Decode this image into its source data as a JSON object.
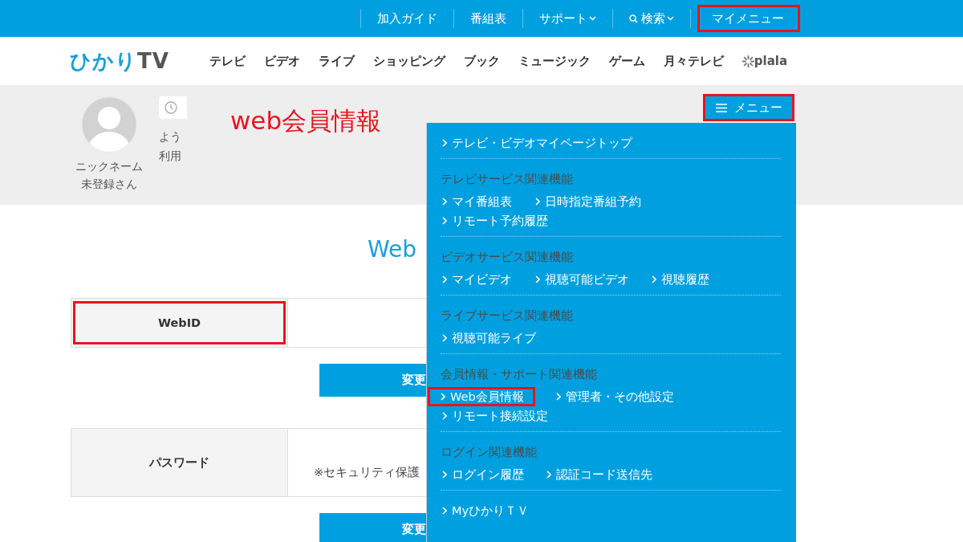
{
  "top_bar": {
    "links": [
      {
        "label": "加入ガイド",
        "kind": "link",
        "highlighted": false
      },
      {
        "label": "番組表",
        "kind": "link",
        "highlighted": false
      },
      {
        "label": "サポート",
        "kind": "dropdown",
        "highlighted": false
      },
      {
        "label": "検索",
        "kind": "search",
        "highlighted": false
      },
      {
        "label": "マイメニュー",
        "kind": "link",
        "highlighted": true
      }
    ]
  },
  "site_nav": {
    "logo_parts": [
      "ひかり",
      "TV"
    ],
    "items": [
      "テレビ",
      "ビデオ",
      "ライブ",
      "ショッピング",
      "ブック",
      "ミュージック",
      "ゲーム",
      "月々テレビ"
    ],
    "partner": "plala"
  },
  "profile": {
    "nickname_lines": [
      "ニックネーム",
      "未登録さん"
    ],
    "welcome_lines": [
      "よう",
      "利用"
    ]
  },
  "annotation": {
    "text": "web会員情報"
  },
  "menu_button": {
    "label": "メニュー",
    "highlighted": true
  },
  "page": {
    "title": "Web",
    "rows": [
      {
        "label": "WebID",
        "highlighted": true,
        "button": "変更"
      },
      {
        "label": "パスワード",
        "highlighted": false,
        "value": "※セキュリティ保護",
        "button": "変更"
      }
    ]
  },
  "dropdown": {
    "sections": [
      {
        "rows": [
          [
            {
              "label": "テレビ・ビデオマイページトップ",
              "highlighted": false
            }
          ]
        ]
      },
      {
        "heading": "テレビサービス関連機能",
        "rows": [
          [
            {
              "label": "マイ番組表",
              "highlighted": false
            },
            {
              "label": "日時指定番組予約",
              "highlighted": false
            }
          ],
          [
            {
              "label": "リモート予約履歴",
              "highlighted": false
            }
          ]
        ]
      },
      {
        "heading": "ビデオサービス関連機能",
        "rows": [
          [
            {
              "label": "マイビデオ",
              "highlighted": false
            },
            {
              "label": "視聴可能ビデオ",
              "highlighted": false
            },
            {
              "label": "視聴履歴",
              "highlighted": false
            }
          ]
        ]
      },
      {
        "heading": "ライブサービス関連機能",
        "rows": [
          [
            {
              "label": "視聴可能ライブ",
              "highlighted": false
            }
          ]
        ]
      },
      {
        "heading": "会員情報・サポート関連機能",
        "rows": [
          [
            {
              "label": "Web会員情報",
              "highlighted": true
            },
            {
              "label": "管理者・その他設定",
              "highlighted": false
            }
          ],
          [
            {
              "label": "リモート接続設定",
              "highlighted": false
            }
          ]
        ]
      },
      {
        "heading": "ログイン関連機能",
        "rows": [
          [
            {
              "label": "ログイン履歴",
              "highlighted": false
            },
            {
              "label": "認証コード送信先",
              "highlighted": false
            }
          ]
        ]
      },
      {
        "rows": [
          [
            {
              "label": "MyひかりＴＶ",
              "highlighted": false
            }
          ]
        ]
      }
    ]
  }
}
